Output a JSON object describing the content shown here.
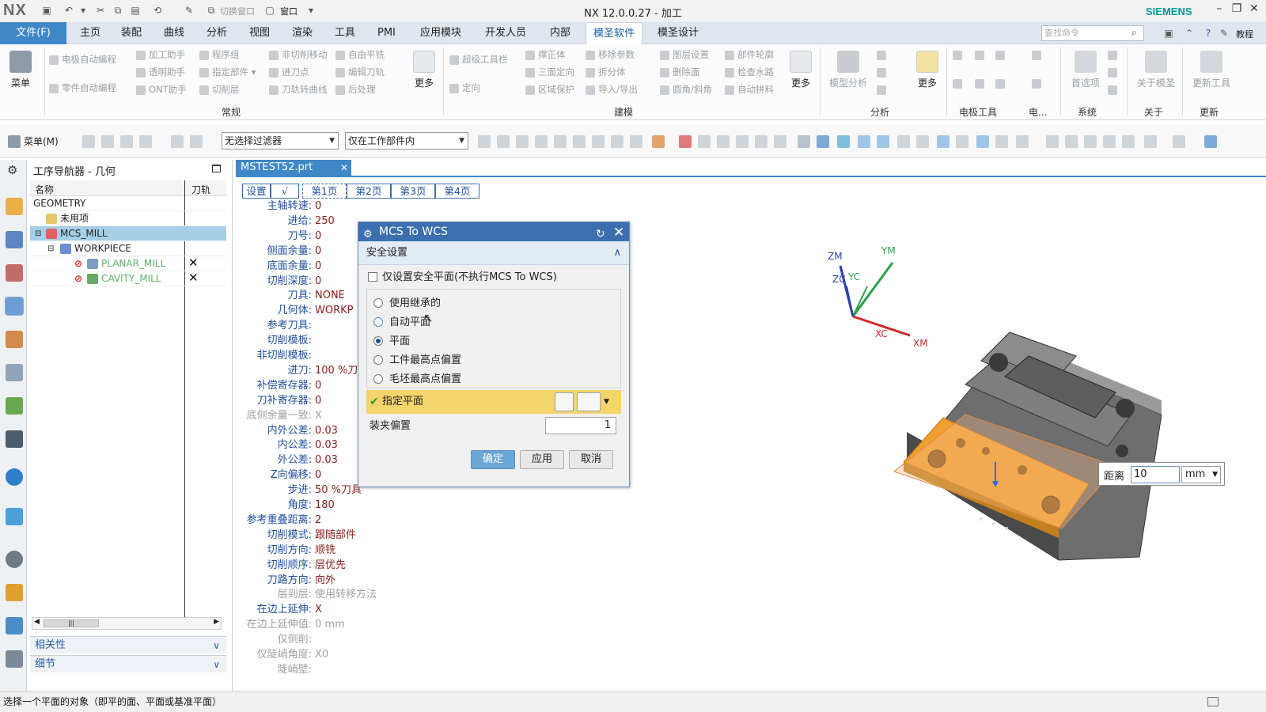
{
  "title_bar": {
    "app_logo": "NX",
    "title": "NX 12.0.0.27 - 加工",
    "brand": "SIEMENS",
    "switch_window": "切换窗口",
    "window_menu": "窗口"
  },
  "menu_bar": {
    "file": "文件(F)",
    "items": [
      "主页",
      "装配",
      "曲线",
      "分析",
      "视图",
      "渲染",
      "工具",
      "PMI",
      "应用模块",
      "开发人员",
      "内部",
      "模圣软件",
      "模圣设计"
    ],
    "active_item": "模圣软件",
    "search_placeholder": "查找命令",
    "tutorial": "教程"
  },
  "ribbon": {
    "menu_button": "菜单",
    "more_label": "更多",
    "groups": {
      "general": "常规",
      "modeling": "建模",
      "analysis": "分析",
      "electrode": "电极工具",
      "electrode_short": "电...",
      "system": "系统",
      "about": "关于",
      "update": "更新"
    },
    "col1": [
      "电极自动编程",
      "零件自动编程"
    ],
    "col2": [
      "加工助手",
      "透明助手",
      "ONT助手"
    ],
    "col3": [
      "程序组",
      "指定部件",
      "切削层"
    ],
    "col4": [
      "非切削移动",
      "进刀点",
      "刀轨转曲线"
    ],
    "col5": [
      "自由平铣",
      "编辑刀轨",
      "后处理"
    ],
    "col6": [
      "超级工具栏",
      "定向"
    ],
    "col7": [
      "撑正体",
      "三面定向",
      "区域保护"
    ],
    "col8": [
      "移除参数",
      "拆分体",
      "导入/导出"
    ],
    "col9": [
      "图层设置",
      "删除面",
      "圆角/斜角"
    ],
    "col10": [
      "部件轮廓",
      "检查水路",
      "自动拼料"
    ],
    "analysis_big": "模型分析",
    "system_big": "首选项",
    "about_big": "关于模圣",
    "update_big": "更新工具"
  },
  "toolbar2": {
    "menu_label": "菜单(M)",
    "filter": "无选择过滤器",
    "scope": "仅在工作部件内"
  },
  "navigator": {
    "title": "工序导航器 - 几何",
    "col_name": "名称",
    "col_path": "刀轨",
    "rows": [
      {
        "label": "GEOMETRY",
        "mark": ""
      },
      {
        "label": "未用项",
        "mark": ""
      },
      {
        "label": "MCS_MILL",
        "mark": ""
      },
      {
        "label": "WORKPIECE",
        "mark": ""
      },
      {
        "label": "PLANAR_MILL",
        "mark": "✕"
      },
      {
        "label": "CAVITY_MILL",
        "mark": "✕"
      }
    ],
    "panel_relevance": "相关性",
    "panel_details": "细节"
  },
  "doc_tab": {
    "name": "MSTEST52.prt"
  },
  "param_tabs": [
    "设置",
    "√",
    "第1页",
    "第2页",
    "第3页",
    "第4页"
  ],
  "params": [
    {
      "label": "主轴转速:",
      "value": "0"
    },
    {
      "label": "进给:",
      "value": "250"
    },
    {
      "label": "刀号:",
      "value": "0"
    },
    {
      "label": "侧面余量:",
      "value": "0"
    },
    {
      "label": "底面余量:",
      "value": "0"
    },
    {
      "label": "切削深度:",
      "value": "0"
    },
    {
      "label": "刀具:",
      "value": "NONE"
    },
    {
      "label": "几何体:",
      "value": "WORKP"
    },
    {
      "label": "参考刀具:",
      "value": ""
    },
    {
      "label": "切削模板:",
      "value": ""
    },
    {
      "label": "非切削模板:",
      "value": ""
    },
    {
      "label": "进刀:",
      "value": "100   %刀"
    },
    {
      "label": "补偿寄存器:",
      "value": "0"
    },
    {
      "label": "刀补寄存器:",
      "value": "0"
    },
    {
      "label": "底侧余量一致:",
      "value": "X"
    },
    {
      "label": "内外公差:",
      "value": "0.03"
    },
    {
      "label": "内公差:",
      "value": "0.03"
    },
    {
      "label": "外公差:",
      "value": "0.03"
    },
    {
      "label": "Z向偏移:",
      "value": "0"
    },
    {
      "label": "步进:",
      "value": "50     %刀具"
    },
    {
      "label": "角度:",
      "value": "180"
    },
    {
      "label": "参考重叠距离:",
      "value": "2"
    },
    {
      "label": "切削模式:",
      "value": "跟随部件"
    },
    {
      "label": "切削方向:",
      "value": "顺铣"
    },
    {
      "label": "切削顺序:",
      "value": "层优先"
    },
    {
      "label": "刀路方向:",
      "value": "向外"
    },
    {
      "label": "层到层:",
      "value": "使用转移方法"
    },
    {
      "label": "在边上延伸:",
      "value": "X"
    },
    {
      "label": "在边上延伸值:",
      "value": "0      mm"
    },
    {
      "label": "仅侧削:",
      "value": ""
    },
    {
      "label": "仅陡峭角度:",
      "value": "X0"
    },
    {
      "label": "陡峭壁:",
      "value": ""
    }
  ],
  "dialog": {
    "title": "MCS To WCS",
    "section": "安全设置",
    "checkbox_label": "仅设置安全平面(不执行MCS To WCS)",
    "radios": [
      "使用继承的",
      "自动平面",
      "平面",
      "工件最高点偏置",
      "毛坯最高点偏置"
    ],
    "selected_radio": "平面",
    "specify_plane": "指定平面",
    "clamp_offset_label": "装夹偏置",
    "clamp_offset_value": "1",
    "ok": "确定",
    "apply": "应用",
    "cancel": "取消"
  },
  "viewport": {
    "axes": [
      "ZM",
      "YM",
      "ZC",
      "YC",
      "XC",
      "XM"
    ],
    "distance_label": "距离",
    "distance_value": "10",
    "distance_unit": "mm"
  },
  "status_bar": {
    "message": "选择一个平面的对象（即平的面、平面或基准平面）"
  },
  "colors": {
    "accent": "#3f87c7",
    "dialog_title": "#3c6fb0",
    "specify_plane_bg": "#f5d46a",
    "param_label": "#1f4fa0",
    "param_value": "#8a1c1c",
    "siemens": "#009999"
  }
}
